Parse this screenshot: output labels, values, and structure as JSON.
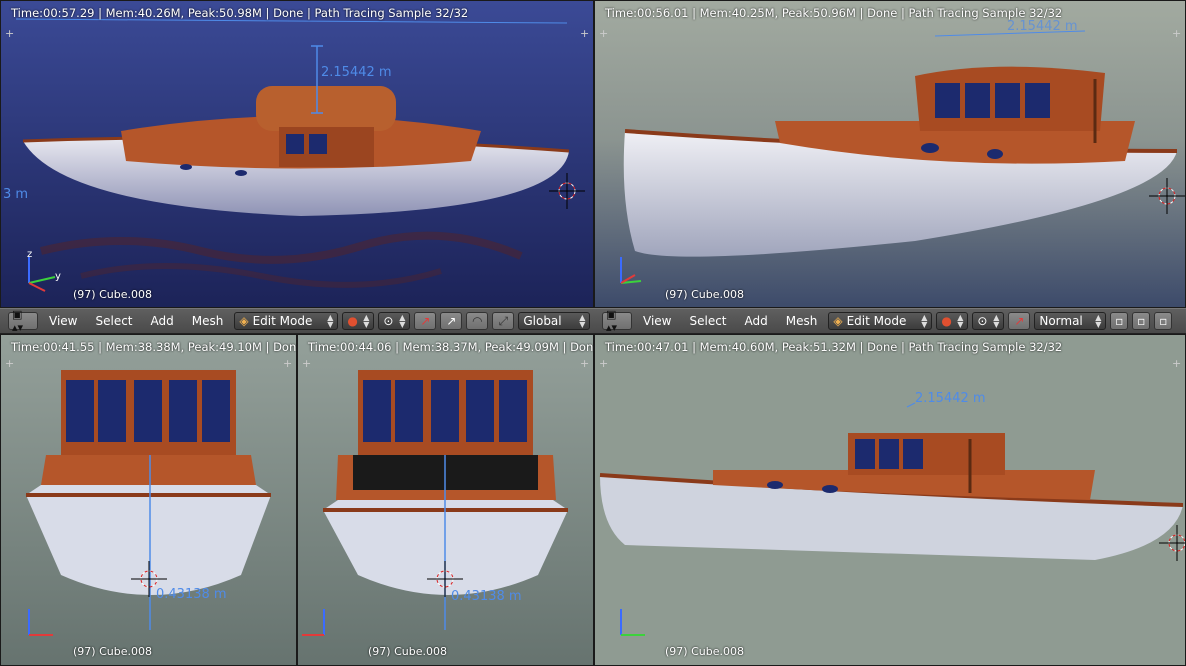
{
  "viewports": [
    {
      "status": "Time:00:57.29 | Mem:40.26M, Peak:50.98M | Done | Path Tracing Sample 32/32",
      "object": "(97) Cube.008",
      "dim_main": "2.15442 m",
      "dim_side": "3 m"
    },
    {
      "status": "Time:00:56.01 | Mem:40.25M, Peak:50.96M | Done | Path Tracing Sample 32/32",
      "object": "(97) Cube.008",
      "dim_main": "2.15442 m"
    },
    {
      "status": "Time:00:41.55 | Mem:38.38M, Peak:49.10M | Don",
      "object": "(97) Cube.008",
      "dim_main": "0.43138 m"
    },
    {
      "status": "Time:00:44.06 | Mem:38.37M, Peak:49.09M | Don",
      "object": "(97) Cube.008",
      "dim_main": "0.43138 m"
    },
    {
      "status": "Time:00:47.01 | Mem:40.60M, Peak:51.32M | Done | Path Tracing Sample 32/32",
      "object": "(97) Cube.008",
      "dim_main": "2.15442 m"
    }
  ],
  "header_left": {
    "menus": [
      "View",
      "Select",
      "Add",
      "Mesh"
    ],
    "mode": "Edit Mode",
    "orientation": "Global"
  },
  "header_right": {
    "menus": [
      "View",
      "Select",
      "Add",
      "Mesh"
    ],
    "mode": "Edit Mode",
    "orientation": "Normal"
  },
  "axis_labels": {
    "z": "z",
    "y": "y",
    "x": "x"
  },
  "colors": {
    "dimension": "#4f8be8",
    "hull": "#d8d8e0",
    "wood": "#b5562a",
    "glass": "#1c2a6e"
  }
}
